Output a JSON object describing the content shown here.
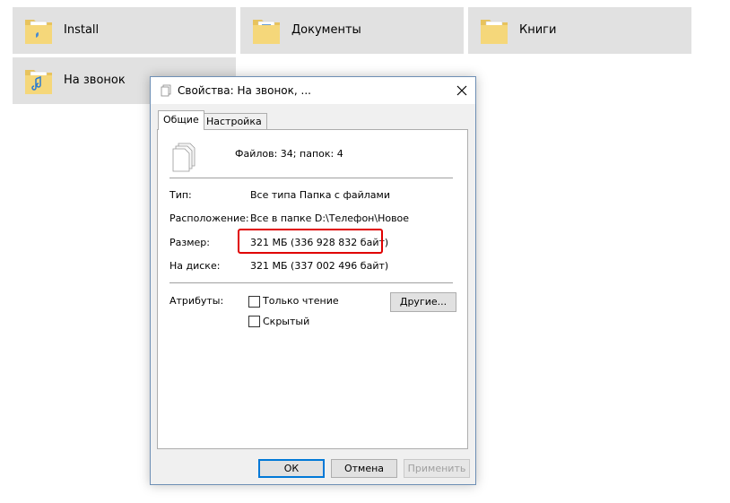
{
  "folders": [
    {
      "label": "Install",
      "icon": "folder-icon"
    },
    {
      "label": "Документы",
      "icon": "folder-documents-icon"
    },
    {
      "label": "Книги",
      "icon": "folder-icon"
    },
    {
      "label": "На звонок",
      "icon": "folder-music-icon"
    }
  ],
  "dialog": {
    "title": "Свойства: На звонок, ...",
    "tabs": [
      "Общие",
      "Настройка"
    ],
    "summary": "Файлов: 34; папок: 4",
    "rows": [
      {
        "label": "Тип:",
        "value": "Все типа Папка с файлами"
      },
      {
        "label": "Расположение:",
        "value": "Все в папке D:\\Телефон\\Новое"
      },
      {
        "label": "Размер:",
        "value": "321 МБ (336 928 832 байт)"
      },
      {
        "label": "На диске:",
        "value": "321 МБ (337 002 496 байт)"
      }
    ],
    "attributes_label": "Атрибуты:",
    "readonly_label": "Только чтение",
    "hidden_label": "Скрытый",
    "other_button": "Другие...",
    "ok_button": "ОК",
    "cancel_button": "Отмена",
    "apply_button": "Применить"
  },
  "colors": {
    "highlight": "#e00000",
    "tile": "#e1e1e1",
    "accent": "#0078d7"
  }
}
